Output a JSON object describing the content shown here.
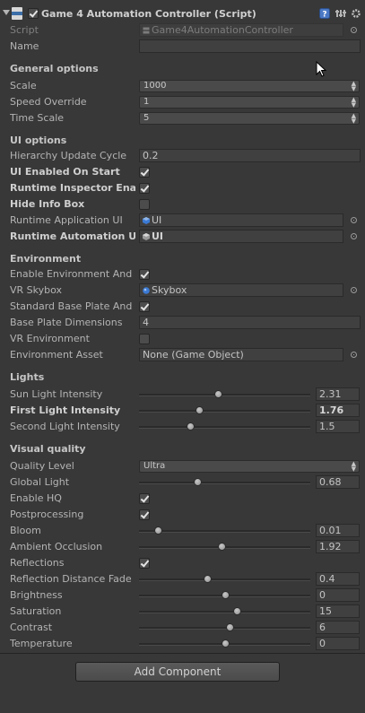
{
  "component": {
    "title": "Game 4 Automation Controller (Script)",
    "enabled": true
  },
  "script_row": {
    "label": "Script",
    "value": "Game4AutomationController"
  },
  "name_row": {
    "label": "Name",
    "value": ""
  },
  "general": {
    "heading": "General options",
    "scale": {
      "label": "Scale",
      "value": "1000"
    },
    "speed_override": {
      "label": "Speed Override",
      "value": "1"
    },
    "time_scale": {
      "label": "Time Scale",
      "value": "5"
    }
  },
  "ui_options": {
    "heading": "UI options",
    "hierarchy_update_cycle": {
      "label": "Hierarchy Update Cycle",
      "value": "0.2"
    },
    "ui_enabled_on_start": {
      "label": "UI Enabled On Start",
      "checked": true
    },
    "runtime_inspector": {
      "label": "Runtime Inspector Enabled",
      "checked": true
    },
    "hide_info_box": {
      "label": "Hide Info Box",
      "checked": false
    },
    "runtime_application_ui": {
      "label": "Runtime Application UI",
      "value": "UI"
    },
    "runtime_automation_ui": {
      "label": "Runtime Automation UI",
      "value": "UI"
    }
  },
  "environment": {
    "heading": "Environment",
    "enable_environment": {
      "label": "Enable Environment And",
      "checked": true
    },
    "vr_skybox": {
      "label": "VR Skybox",
      "value": "Skybox"
    },
    "standard_base_plate": {
      "label": "Standard Base Plate And",
      "checked": true
    },
    "base_plate_dimensions": {
      "label": "Base Plate Dimensions",
      "value": "4"
    },
    "vr_environment": {
      "label": "VR Environment",
      "checked": false
    },
    "environment_asset": {
      "label": "Environment Asset",
      "value": "None (Game Object)"
    }
  },
  "lights": {
    "heading": "Lights",
    "sun": {
      "label": "Sun Light Intensity",
      "value": "2.31",
      "fraction": 0.46
    },
    "first": {
      "label": "First Light Intensity",
      "value": "1.76",
      "fraction": 0.35
    },
    "second": {
      "label": "Second Light Intensity",
      "value": "1.5",
      "fraction": 0.3
    }
  },
  "visual": {
    "heading": "Visual quality",
    "quality_level": {
      "label": "Quality Level",
      "value": "Ultra"
    },
    "global_light": {
      "label": "Global Light",
      "value": "0.68",
      "fraction": 0.34
    },
    "enable_hq": {
      "label": "Enable HQ",
      "checked": true
    },
    "postprocessing": {
      "label": "Postprocessing",
      "checked": true
    },
    "bloom": {
      "label": "Bloom",
      "value": "0.01",
      "fraction": 0.11
    },
    "ambient_occlusion": {
      "label": "Ambient Occlusion",
      "value": "1.92",
      "fraction": 0.48
    },
    "reflections": {
      "label": "Reflections",
      "checked": true
    },
    "reflection_distance_fade": {
      "label": "Reflection Distance Fade",
      "value": "0.4",
      "fraction": 0.4
    },
    "brightness": {
      "label": "Brightness",
      "value": "0",
      "fraction": 0.5
    },
    "saturation": {
      "label": "Saturation",
      "value": "15",
      "fraction": 0.57
    },
    "contrast": {
      "label": "Contrast",
      "value": "6",
      "fraction": 0.53
    },
    "temperature": {
      "label": "Temperature",
      "value": "0",
      "fraction": 0.5
    }
  },
  "add_component": "Add Component",
  "colors": {
    "bg": "#383838",
    "text": "#b4b4b4",
    "field": "#404040",
    "asset_icon": "#3b7ad4"
  },
  "icons": [
    "script-icon",
    "help-icon",
    "preset-icon",
    "gear-icon",
    "object-picker-icon",
    "mouse-cursor-icon"
  ]
}
